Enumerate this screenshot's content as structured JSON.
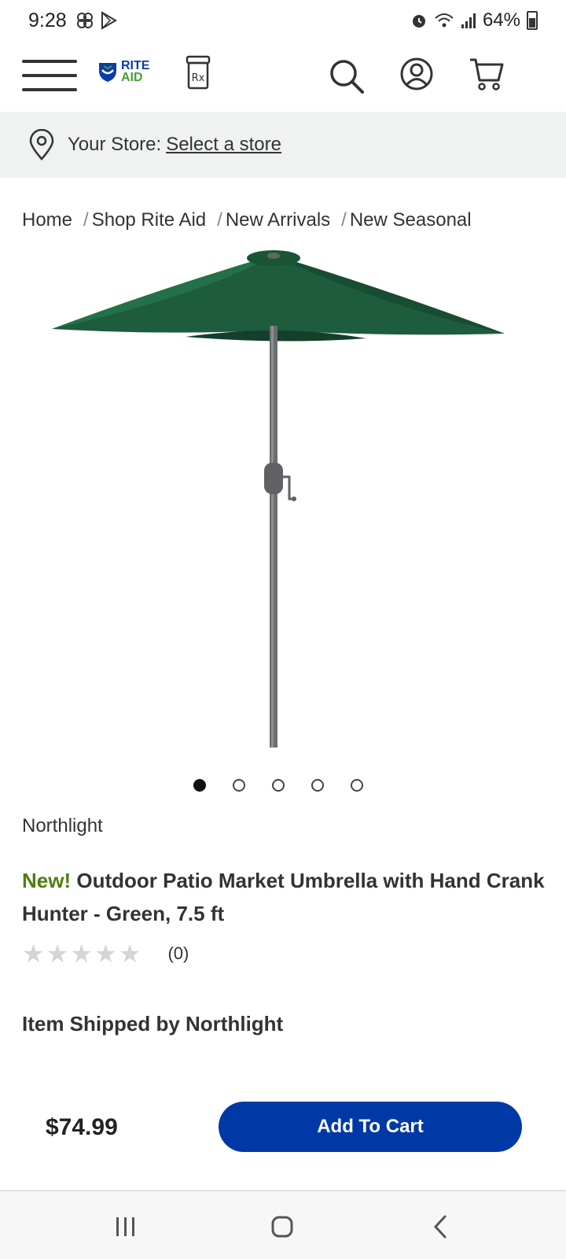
{
  "status_bar": {
    "time": "9:28",
    "battery": "64%"
  },
  "header": {
    "logo_line1": "RITE",
    "logo_line2": "AID",
    "rx_label": "Rx"
  },
  "store": {
    "label": "Your Store:",
    "link": "Select a store"
  },
  "breadcrumb": [
    "Home",
    "Shop Rite Aid",
    "New Arrivals",
    "New Seasonal"
  ],
  "carousel": {
    "active_index": 0,
    "count": 5
  },
  "product": {
    "brand": "Northlight",
    "badge": "New!",
    "title": "Outdoor Patio Market Umbrella with Hand Crank Hunter - Green, 7.5 ft",
    "rating_stars": 0,
    "rating_count": "(0)",
    "shipped_by": "Item Shipped by Northlight",
    "price": "$74.99",
    "add_to_cart": "Add To Cart"
  },
  "colors": {
    "primary_button": "#0039a6",
    "new_badge": "#4e7d13",
    "umbrella_canopy": "#1d5c3c"
  }
}
